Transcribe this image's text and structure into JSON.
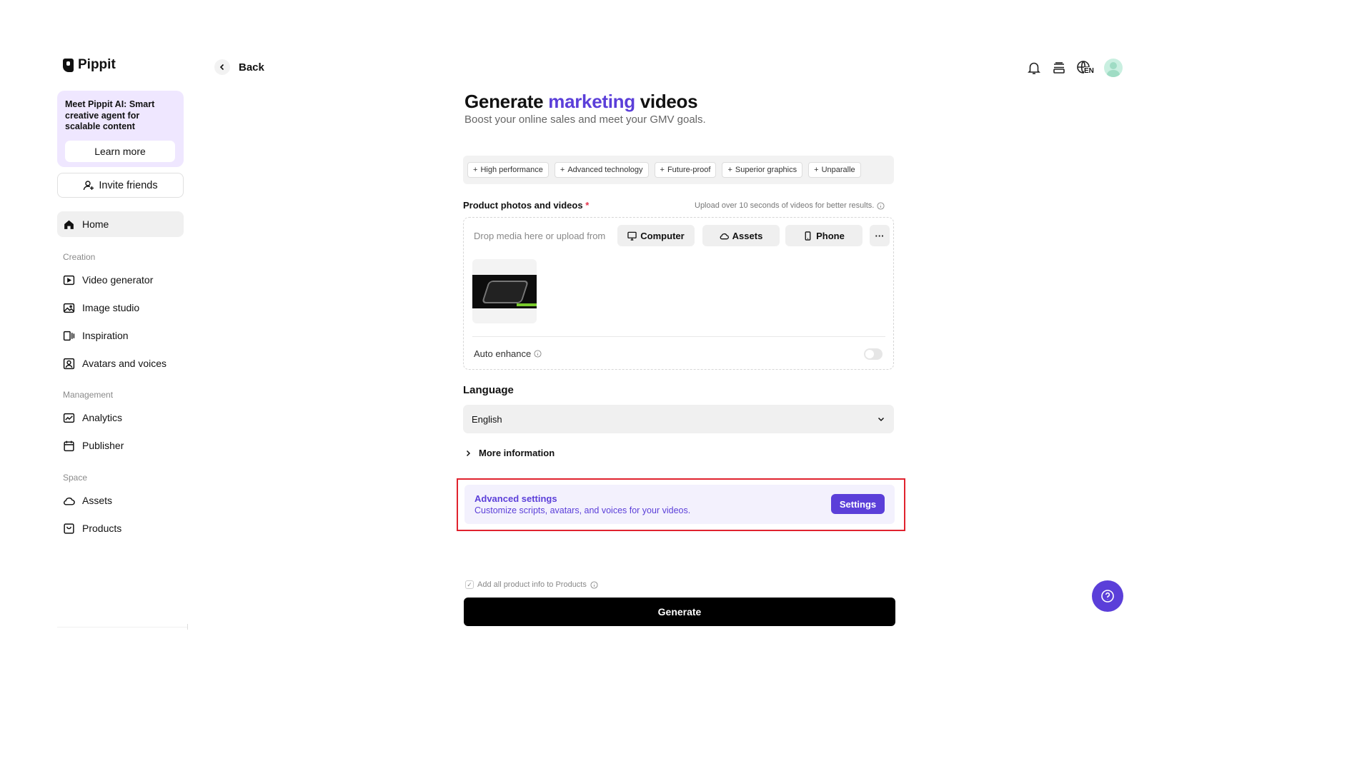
{
  "app": {
    "name": "Pippit"
  },
  "sidebar": {
    "promo_text": "Meet Pippit AI: Smart creative agent for scalable content",
    "learn_more": "Learn more",
    "invite": "Invite friends",
    "home": "Home",
    "sections": {
      "creation": "Creation",
      "management": "Management",
      "space": "Space"
    },
    "creation_items": [
      "Video generator",
      "Image studio",
      "Inspiration",
      "Avatars and voices"
    ],
    "management_items": [
      "Analytics",
      "Publisher"
    ],
    "space_items": [
      "Assets",
      "Products"
    ]
  },
  "header": {
    "back": "Back",
    "lang_badge": "EN"
  },
  "main": {
    "title_part1": "Generate ",
    "title_accent": "marketing",
    "title_part2": " videos",
    "subtitle": "Boost your online sales and meet your GMV goals.",
    "tags": [
      "High performance",
      "Advanced technology",
      "Future-proof",
      "Superior graphics",
      "Unparalle"
    ],
    "photos_label": "Product photos and videos",
    "required_mark": "*",
    "upload_hint": "Upload over 10 seconds of videos for better results.",
    "drop_text": "Drop media here or upload from",
    "sources": {
      "computer": "Computer",
      "assets": "Assets",
      "phone": "Phone",
      "more": "···"
    },
    "auto_enhance": "Auto enhance",
    "language_label": "Language",
    "language_value": "English",
    "more_info": "More information",
    "advanced": {
      "title": "Advanced settings",
      "desc": "Customize scripts, avatars, and voices for your videos.",
      "button": "Settings"
    },
    "add_all": "Add all product info to Products",
    "generate": "Generate"
  },
  "colors": {
    "accent": "#5b3fd9",
    "highlight_outline": "#e0222e",
    "promo_bg": "#efe7ff"
  }
}
